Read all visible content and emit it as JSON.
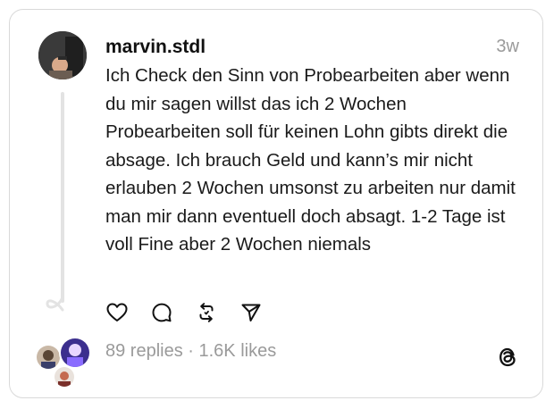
{
  "post": {
    "username": "marvin.stdl",
    "time": "3w",
    "text": "Ich Check den Sinn von Probearbeiten aber wenn du mir sagen willst das ich 2 Wochen Probearbeiten soll für keinen Lohn gibts direkt die absage. Ich brauch Geld und kann’s mir nicht erlauben 2 Wochen umsonst zu arbeiten nur damit man mir dann eventuell doch absagt. 1-2 Tage ist voll Fine aber 2 Wochen niemals"
  },
  "actions": [
    {
      "name": "like",
      "icon": "heart-icon"
    },
    {
      "name": "reply",
      "icon": "comment-icon"
    },
    {
      "name": "repost",
      "icon": "repost-icon"
    },
    {
      "name": "share",
      "icon": "send-icon"
    }
  ],
  "stats": {
    "replies": "89 replies",
    "separator": " · ",
    "likes": "1.6K likes"
  },
  "brand_icon": "threads-logo-icon",
  "colors": {
    "text": "#1a1a1a",
    "muted": "#9a9a9a",
    "border": "#d9d9d9",
    "thread_line": "#e3e3e3"
  }
}
